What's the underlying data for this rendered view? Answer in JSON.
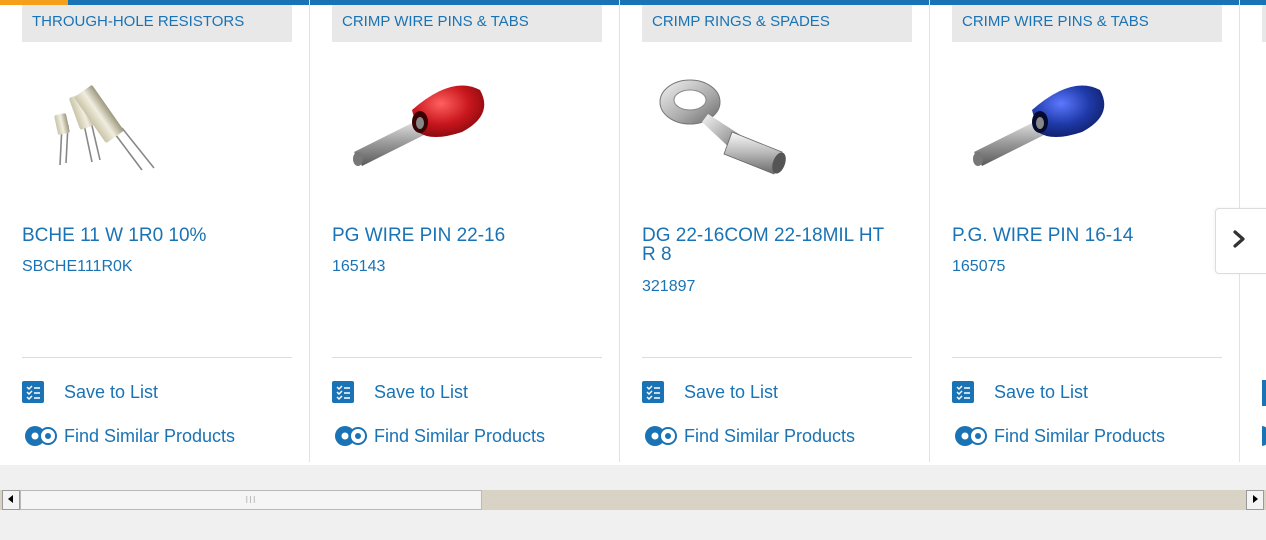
{
  "cards": [
    {
      "category": "THROUGH-HOLE RESISTORS",
      "title": "BCHE 11 W 1R0 10%",
      "part_number": "SBCHE111R0K",
      "save_label": "Save to List",
      "find_label": "Find Similar Products",
      "image": "resistor-image"
    },
    {
      "category": "CRIMP WIRE PINS & TABS",
      "title": "PG WIRE PIN 22-16",
      "part_number": "165143",
      "save_label": "Save to List",
      "find_label": "Find Similar Products",
      "image": "red-wire-pin-image"
    },
    {
      "category": "CRIMP RINGS & SPADES",
      "title": "DG 22-16COM 22-18MIL HT R 8",
      "part_number": "321897",
      "save_label": "Save to List",
      "find_label": "Find Similar Products",
      "image": "ring-terminal-image"
    },
    {
      "category": "CRIMP WIRE PINS & TABS",
      "title": "P.G. WIRE PIN 16-14",
      "part_number": "165075",
      "save_label": "Save to List",
      "find_label": "Find Similar Products",
      "image": "blue-wire-pin-image"
    }
  ],
  "carousel": {
    "next_icon": "chevron-right-icon"
  },
  "scrollbar": {
    "left_icon": "triangle-left-icon",
    "right_icon": "triangle-right-icon",
    "thumb_grip": "III"
  },
  "colors": {
    "link": "#1a73b4",
    "accent": "#f5a01a",
    "category_bg": "#e8e8e8",
    "red_pin": "#c8161d",
    "blue_pin": "#1f3aa8"
  }
}
